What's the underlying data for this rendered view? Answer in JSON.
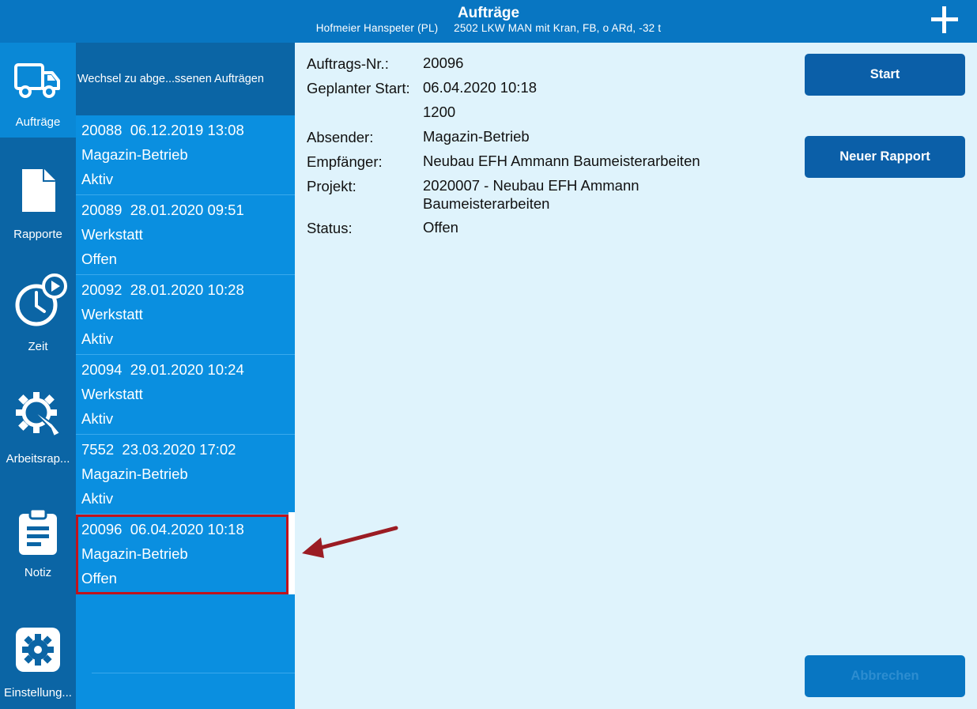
{
  "header": {
    "title": "Aufträge",
    "subtitle": "Hofmeier Hanspeter (PL)     2502 LKW MAN mit Kran, FB, o ARd, -32 t",
    "add_icon": "plus-icon"
  },
  "nav": {
    "items": [
      {
        "label": "Aufträge",
        "icon": "truck-icon"
      },
      {
        "label": "Rapporte",
        "icon": "document-icon"
      },
      {
        "label": "Zeit",
        "icon": "clock-play-icon"
      },
      {
        "label": "Arbeitsrap...",
        "icon": "gear-wrench-icon"
      },
      {
        "label": "Notiz",
        "icon": "clipboard-icon"
      },
      {
        "label": "Einstellung...",
        "icon": "settings-icon"
      }
    ]
  },
  "list": {
    "switch_label": "Wechsel zu abge...ssenen Aufträgen",
    "orders": [
      {
        "line1": "20088  06.12.2019 13:08",
        "location": "Magazin-Betrieb",
        "status": "Aktiv"
      },
      {
        "line1": "20089  28.01.2020 09:51",
        "location": "Werkstatt",
        "status": "Offen"
      },
      {
        "line1": "20092  28.01.2020 10:28",
        "location": "Werkstatt",
        "status": "Aktiv"
      },
      {
        "line1": "20094  29.01.2020 10:24",
        "location": "Werkstatt",
        "status": "Aktiv"
      },
      {
        "line1": "7552  23.03.2020 17:02",
        "location": "Magazin-Betrieb",
        "status": "Aktiv"
      },
      {
        "line1": "20096  06.04.2020 10:18",
        "location": "Magazin-Betrieb",
        "status": "Offen"
      }
    ]
  },
  "detail": {
    "labels": {
      "order_no": "Auftrags-Nr.:",
      "planned_start": "Geplanter Start:",
      "sender": "Absender:",
      "recipient": "Empfänger:",
      "project": "Projekt:",
      "status": "Status:"
    },
    "values": {
      "order_no": "20096",
      "planned_start": "06.04.2020 10:18",
      "extra": "1200",
      "sender": "Magazin-Betrieb",
      "recipient": "Neubau EFH Ammann Baumeisterarbeiten",
      "project": "2020007 - Neubau EFH Ammann Baumeisterarbeiten",
      "status": "Offen"
    },
    "buttons": {
      "start": "Start",
      "new_report": "Neuer Rapport",
      "cancel": "Abbrechen"
    }
  },
  "colors": {
    "header": "#0876c2",
    "nav": "#0b65a5",
    "nav_active": "#0a88d6",
    "list": "#0a8fe0",
    "detail_bg": "#dff3fc",
    "button": "#0b5fa8",
    "highlight": "#c0121b",
    "arrow": "#9b1c23"
  }
}
